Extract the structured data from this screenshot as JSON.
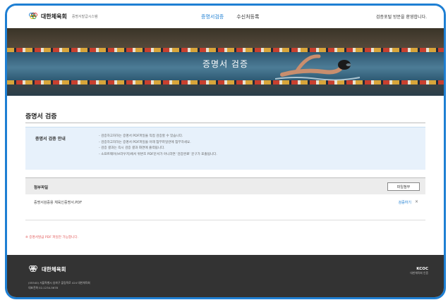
{
  "header": {
    "logo_name": "대한체육회",
    "logo_sub": "증명서발급시스템",
    "nav": [
      "증명서검증",
      "수신처등록"
    ],
    "welcome": "검증포털 방문을 환영합니다."
  },
  "banner": {
    "title": "증명서 검증"
  },
  "main": {
    "page_title": "증명서 검증",
    "guide": {
      "label": "증명서 검증 안내",
      "items": [
        "- 검증하고자하는 증명서 PDF파일을 직접 검증할 수 있습니다.",
        "- 검증하고자하는 증명서 PDF파일을 아래 첨부파일란에 첨부하세요.",
        "- 검증 결과는 즉시 검증 결과 화면에 출력됩니다.",
        "- 소프트웨어(브라우저)에서 위변조 PDF문서가 아니라면 '검증완료' 문구가 표출됩니다."
      ]
    },
    "attach": {
      "label": "첨부파일",
      "button": "파일첨부",
      "file_name": "증명서검증용 체육인증명서.PDF",
      "file_action": "검증하기",
      "remove": "×"
    },
    "notice": "※ 증명서발급 PDF 파일만 가능합니다."
  },
  "footer": {
    "name": "대한체육회",
    "address_lines": [
      "(05540) 서울특별시 송파구 올림픽로 424 대한체육회",
      "대표전화 02-1234-5678"
    ],
    "badge_main": "KCOC",
    "badge_sub": "대한체육회 인증"
  },
  "colors": {
    "accent": "#1e7fd3",
    "footer_bg": "#333333",
    "guide_bg": "#e7f1fb",
    "notice": "#e25c5c"
  }
}
